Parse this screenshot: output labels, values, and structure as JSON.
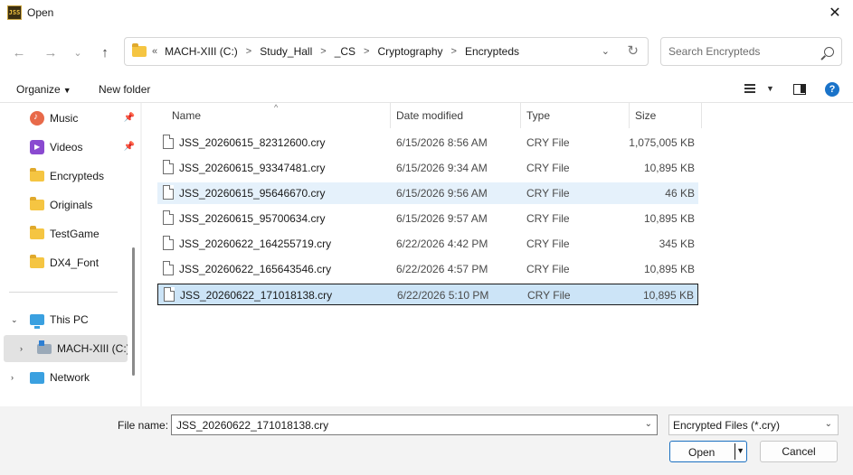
{
  "window": {
    "title": "Open",
    "app_icon_text": "JSS"
  },
  "address": {
    "overflow": "«",
    "crumbs": [
      "MACH-XIII (C:)",
      "Study_Hall",
      "_CS",
      "Cryptography",
      "Encrypteds"
    ]
  },
  "search": {
    "placeholder": "Search Encrypteds"
  },
  "toolbar": {
    "organize": "Organize",
    "new_folder": "New folder"
  },
  "sidebar": {
    "quick_access": [
      {
        "label": "Music",
        "icon": "music-icon",
        "pinned": true
      },
      {
        "label": "Videos",
        "icon": "videos-icon",
        "pinned": true
      },
      {
        "label": "Encrypteds",
        "icon": "folder-icon"
      },
      {
        "label": "Originals",
        "icon": "folder-icon"
      },
      {
        "label": "TestGame",
        "icon": "folder-icon"
      },
      {
        "label": "DX4_Font",
        "icon": "folder-icon"
      }
    ],
    "this_pc": "This PC",
    "drive": "MACH-XIII (C:)",
    "network": "Network"
  },
  "columns": {
    "name": "Name",
    "date": "Date modified",
    "type": "Type",
    "size": "Size"
  },
  "files": [
    {
      "name": "JSS_20260615_82312600.cry",
      "date": "6/15/2026 8:56 AM",
      "type": "CRY File",
      "size": "1,075,005 KB"
    },
    {
      "name": "JSS_20260615_93347481.cry",
      "date": "6/15/2026 9:34 AM",
      "type": "CRY File",
      "size": "10,895 KB"
    },
    {
      "name": "JSS_20260615_95646670.cry",
      "date": "6/15/2026 9:56 AM",
      "type": "CRY File",
      "size": "46 KB"
    },
    {
      "name": "JSS_20260615_95700634.cry",
      "date": "6/15/2026 9:57 AM",
      "type": "CRY File",
      "size": "10,895 KB"
    },
    {
      "name": "JSS_20260622_164255719.cry",
      "date": "6/22/2026 4:42 PM",
      "type": "CRY File",
      "size": "345 KB"
    },
    {
      "name": "JSS_20260622_165643546.cry",
      "date": "6/22/2026 4:57 PM",
      "type": "CRY File",
      "size": "10,895 KB"
    },
    {
      "name": "JSS_20260622_171018138.cry",
      "date": "6/22/2026 5:10 PM",
      "type": "CRY File",
      "size": "10,895 KB"
    }
  ],
  "footer": {
    "file_name_label": "File name:",
    "file_name_value": "JSS_20260622_171018138.cry",
    "filter": "Encrypted Files (*.cry)",
    "open": "Open",
    "cancel": "Cancel"
  }
}
